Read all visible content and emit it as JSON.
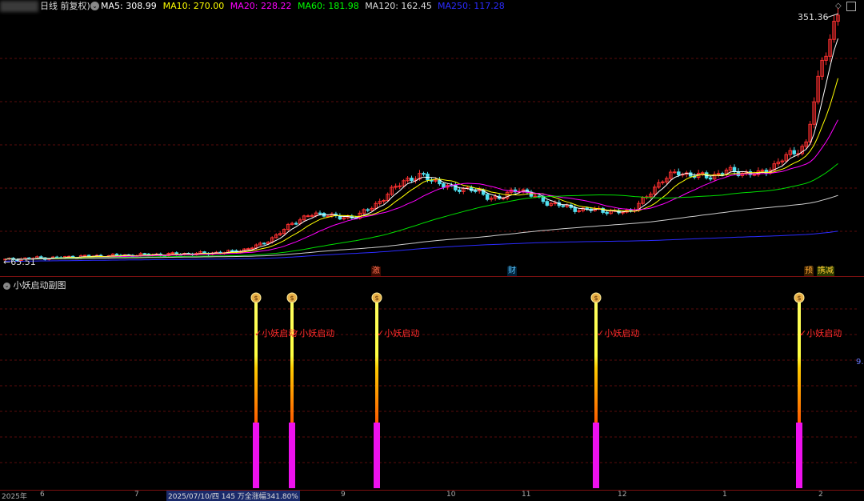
{
  "header": {
    "title_suffix": "日线 前复权)",
    "ma": [
      {
        "label": "MA5: 308.99",
        "color": "#ffffff"
      },
      {
        "label": "MA10: 270.00",
        "color": "#ffff00"
      },
      {
        "label": "MA20: 228.22",
        "color": "#ff00ff"
      },
      {
        "label": "MA60: 181.98",
        "color": "#00ff00"
      },
      {
        "label": "MA120: 162.45",
        "color": "#dddddd"
      },
      {
        "label": "MA250: 117.28",
        "color": "#2b2bff"
      }
    ]
  },
  "main": {
    "high_label": "351.36",
    "low_label": "65.51",
    "low_arrow": "←",
    "badges": [
      {
        "text": "激",
        "color": "#ff7050"
      },
      {
        "text": "财",
        "color": "#5ac8ff"
      },
      {
        "text": "预",
        "color": "#ffaa33"
      },
      {
        "text": "携减",
        "color": "#ffcc33"
      }
    ]
  },
  "sub": {
    "title": "小妖启动副图",
    "signal_text": "✓小妖启动",
    "right_value": "9.",
    "signal_count": 5
  },
  "axis": {
    "labels": [
      "2025年",
      "6",
      "7",
      "2025/07/10/四 145 万全涨幅341.80%",
      "9",
      "10",
      "11",
      "12",
      "1",
      "2"
    ]
  },
  "chart_data": {
    "type": "candlestick",
    "ma_values": {
      "MA5": 308.99,
      "MA10": 270.0,
      "MA20": 228.22,
      "MA60": 181.98,
      "MA120": 162.45,
      "MA250": 117.28
    },
    "high": 351.36,
    "low": 65.51,
    "close_trend": [
      66,
      67,
      68,
      68,
      69,
      70,
      70,
      71,
      71,
      72,
      72,
      73,
      73,
      74,
      75,
      78,
      84,
      95,
      110,
      118,
      120,
      114,
      118,
      128,
      145,
      160,
      164,
      157,
      148,
      150,
      140,
      138,
      150,
      140,
      132,
      128,
      124,
      125,
      121,
      123,
      138,
      160,
      168,
      165,
      163,
      170,
      168,
      166,
      176,
      190,
      200,
      300,
      351
    ],
    "signal_positions": [
      0.296,
      0.338,
      0.436,
      0.69,
      0.925
    ]
  }
}
